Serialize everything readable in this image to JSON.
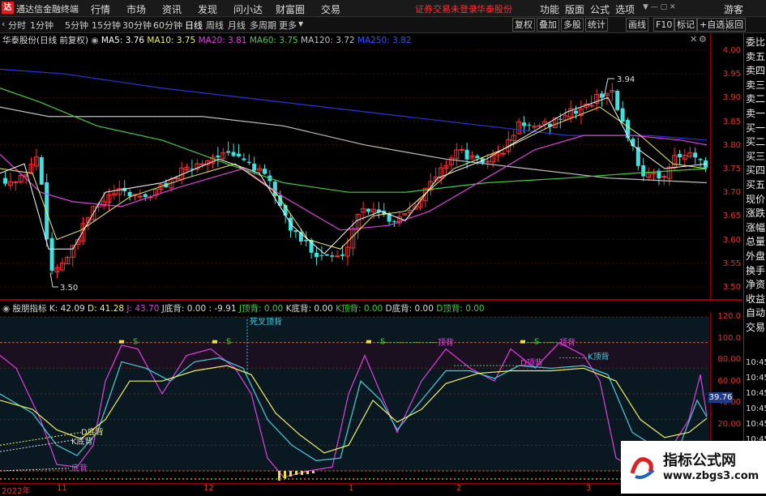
{
  "menubar": {
    "app_title": "通达信金融终端",
    "items": [
      "行情",
      "市场",
      "资讯",
      "发现",
      "问小达",
      "财富圈",
      "交易"
    ],
    "warning": "证券交易未登录",
    "broker": "华泰股份",
    "right_items": [
      "功能",
      "版面",
      "公式",
      "选项"
    ],
    "guest": "游客"
  },
  "periodbar": {
    "items": [
      "分时",
      "1分钟",
      "5分钟",
      "15分钟",
      "30分钟",
      "60分钟",
      "日线",
      "周线",
      "月线",
      "多周期",
      "更多"
    ],
    "active": "日线",
    "right_buttons": [
      "复权",
      "叠加",
      "多股",
      "统计",
      "画线",
      "F10",
      "标记",
      "+自选",
      "返回"
    ]
  },
  "main_legend": {
    "stock": "华泰股份(日线 前复权)",
    "ma5": "MA5: 3.76",
    "ma10": "MA10: 3.75",
    "ma20": "MA20: 3.81",
    "ma60": "MA60: 3.75",
    "ma120": "MA120: 3.72",
    "ma250": "MA250: 3.82"
  },
  "price_ticks": [
    "4.00",
    "3.95",
    "3.90",
    "3.85",
    "3.80",
    "3.75",
    "3.70",
    "3.65",
    "3.60",
    "3.55",
    "3.50"
  ],
  "annotations": {
    "high": "3.94",
    "low": "3.50"
  },
  "indicator_legend": {
    "name": "殷朋指标",
    "k": "K: 42.09",
    "d": "D: 41.28",
    "j": "J: 43.70",
    "j_back": "J底背: 0.00",
    "val": ": -9.91",
    "j_top": "J顶背: 0.00",
    "k_back": "K底背: 0.00",
    "k_top": "K顶背: 0.00",
    "d_back": "D底背: 0.00",
    "d_top": "D顶背: 0.00"
  },
  "indicator_ticks": [
    "120.0",
    "100.0",
    "80.00",
    "60.00",
    "40.00",
    "20.00",
    "0.00"
  ],
  "indicator_current": "39.76",
  "indicator_labels": {
    "s": "S",
    "dead_cross_top": "死叉顶背",
    "top_back": "顶背",
    "d_top_back": "D顶背",
    "k_top_back": "K顶背",
    "d_bottom_back": "D底背",
    "k_bottom_back": "K底背",
    "bottom_back": "底背"
  },
  "side_panel": [
    "委比",
    "卖五",
    "卖四",
    "卖三",
    "卖二",
    "卖一",
    "买一",
    "买二",
    "买三",
    "买四",
    "买五",
    "现价",
    "涨跌",
    "涨幅",
    "总量",
    "外盘",
    "换手",
    "净资",
    "收益",
    "自动",
    "交易"
  ],
  "side_times": [
    "10:45",
    "10:45",
    "10:45",
    "10:45",
    "10:45",
    "10:45",
    "10:45"
  ],
  "time_axis": [
    "2022年",
    "11",
    "12",
    "1",
    "2",
    "3"
  ],
  "watermark": {
    "title": "指标公式网",
    "url": "www.zbgs3.com"
  },
  "colors": {
    "up": "#ff3030",
    "down": "#40e0e0",
    "ma5": "#ffffff",
    "ma10": "#f0f060",
    "ma20": "#e040e0",
    "ma60": "#40d040",
    "ma120": "#c0c0c0",
    "ma250": "#3030e0"
  }
}
